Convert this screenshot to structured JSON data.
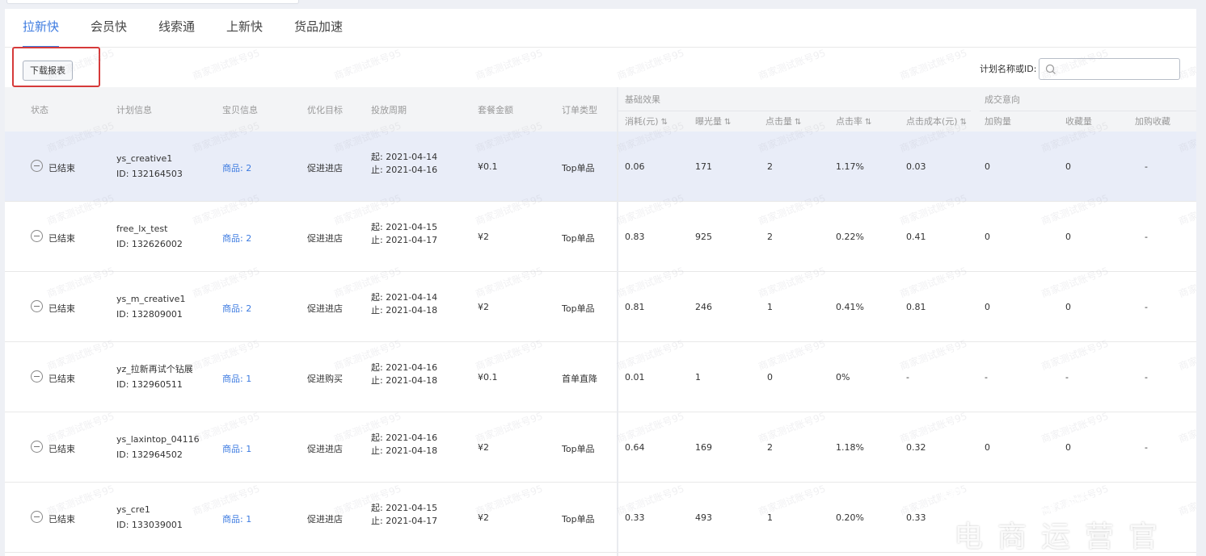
{
  "tabs": [
    "拉新快",
    "会员快",
    "线索通",
    "上新快",
    "货品加速"
  ],
  "toolbar": {
    "download_label": "下载报表"
  },
  "search": {
    "label": "计划名称或ID:",
    "placeholder": ""
  },
  "table": {
    "headers": {
      "status": "状态",
      "plan": "计划信息",
      "item": "宝贝信息",
      "goal": "优化目标",
      "period": "投放周期",
      "amount": "套餐金额",
      "order_type": "订单类型",
      "group_basic": "基础效果",
      "cost": "消耗(元)",
      "impressions": "曝光量",
      "clicks": "点击量",
      "ctr": "点击率",
      "cpc": "点击成本(元)",
      "group_intent": "成交意向",
      "cart": "加购量",
      "fav": "收藏量",
      "cartfav": "加购收藏"
    },
    "sort_icon": "⇅",
    "rows": [
      {
        "status": "已结束",
        "name": "ys_creative1",
        "id": "ID: 132164503",
        "item": "商品: 2",
        "goal": "促进进店",
        "start": "起: 2021-04-14",
        "end": "止: 2021-04-16",
        "amount": "¥0.1",
        "order_type": "Top单品",
        "cost": "0.06",
        "impressions": "171",
        "clicks": "2",
        "ctr": "1.17%",
        "cpc": "0.03",
        "cart": "0",
        "fav": "0",
        "cartfav": "-"
      },
      {
        "status": "已结束",
        "name": "free_lx_test",
        "id": "ID: 132626002",
        "item": "商品: 2",
        "goal": "促进进店",
        "start": "起: 2021-04-15",
        "end": "止: 2021-04-17",
        "amount": "¥2",
        "order_type": "Top单品",
        "cost": "0.83",
        "impressions": "925",
        "clicks": "2",
        "ctr": "0.22%",
        "cpc": "0.41",
        "cart": "0",
        "fav": "0",
        "cartfav": "-"
      },
      {
        "status": "已结束",
        "name": "ys_m_creative1",
        "id": "ID: 132809001",
        "item": "商品: 2",
        "goal": "促进进店",
        "start": "起: 2021-04-14",
        "end": "止: 2021-04-18",
        "amount": "¥2",
        "order_type": "Top单品",
        "cost": "0.81",
        "impressions": "246",
        "clicks": "1",
        "ctr": "0.41%",
        "cpc": "0.81",
        "cart": "0",
        "fav": "0",
        "cartfav": "-"
      },
      {
        "status": "已结束",
        "name": "yz_拉新再试个钻展",
        "id": "ID: 132960511",
        "item": "商品: 1",
        "goal": "促进购买",
        "start": "起: 2021-04-16",
        "end": "止: 2021-04-18",
        "amount": "¥0.1",
        "order_type": "首单直降",
        "cost": "0.01",
        "impressions": "1",
        "clicks": "0",
        "ctr": "0%",
        "cpc": "-",
        "cart": "-",
        "fav": "-",
        "cartfav": "-"
      },
      {
        "status": "已结束",
        "name": "ys_laxintop_04116",
        "id": "ID: 132964502",
        "item": "商品: 1",
        "goal": "促进进店",
        "start": "起: 2021-04-16",
        "end": "止: 2021-04-18",
        "amount": "¥2",
        "order_type": "Top单品",
        "cost": "0.64",
        "impressions": "169",
        "clicks": "2",
        "ctr": "1.18%",
        "cpc": "0.32",
        "cart": "0",
        "fav": "0",
        "cartfav": "-"
      },
      {
        "status": "已结束",
        "name": "ys_cre1",
        "id": "ID: 133039001",
        "item": "商品: 1",
        "goal": "促进进店",
        "start": "起: 2021-04-15",
        "end": "止: 2021-04-17",
        "amount": "¥2",
        "order_type": "Top单品",
        "cost": "0.33",
        "impressions": "493",
        "clicks": "1",
        "ctr": "0.20%",
        "cpc": "0.33",
        "cart": "",
        "fav": "",
        "cartfav": ""
      }
    ]
  },
  "watermark_text": "商家测试账号95",
  "brand": {
    "line1": "电商运营官",
    "line2": "电商运营官"
  },
  "colors": {
    "accent": "#3d7be0",
    "highlight_row": "#e9edf8",
    "highlight_box": "#d63a3a"
  }
}
